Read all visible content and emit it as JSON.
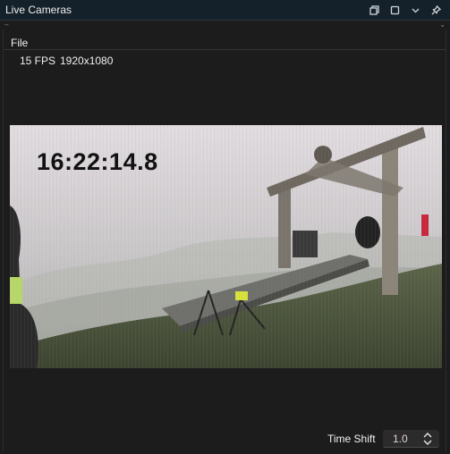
{
  "window": {
    "title": "Live Cameras",
    "buttons": [
      "restore-icon",
      "maximize-icon",
      "chevron-down-icon",
      "pin-icon"
    ]
  },
  "menu": {
    "file_label": "File"
  },
  "stream": {
    "fps": "15 FPS",
    "resolution": "1920x1080"
  },
  "video": {
    "timestamp": "16:22:14.8"
  },
  "timeshift": {
    "label": "Time Shift",
    "value": "1.0"
  },
  "colors": {
    "titlebar": "#15212a",
    "background": "#1c1c1c",
    "value_text": "#e5d2cf"
  }
}
